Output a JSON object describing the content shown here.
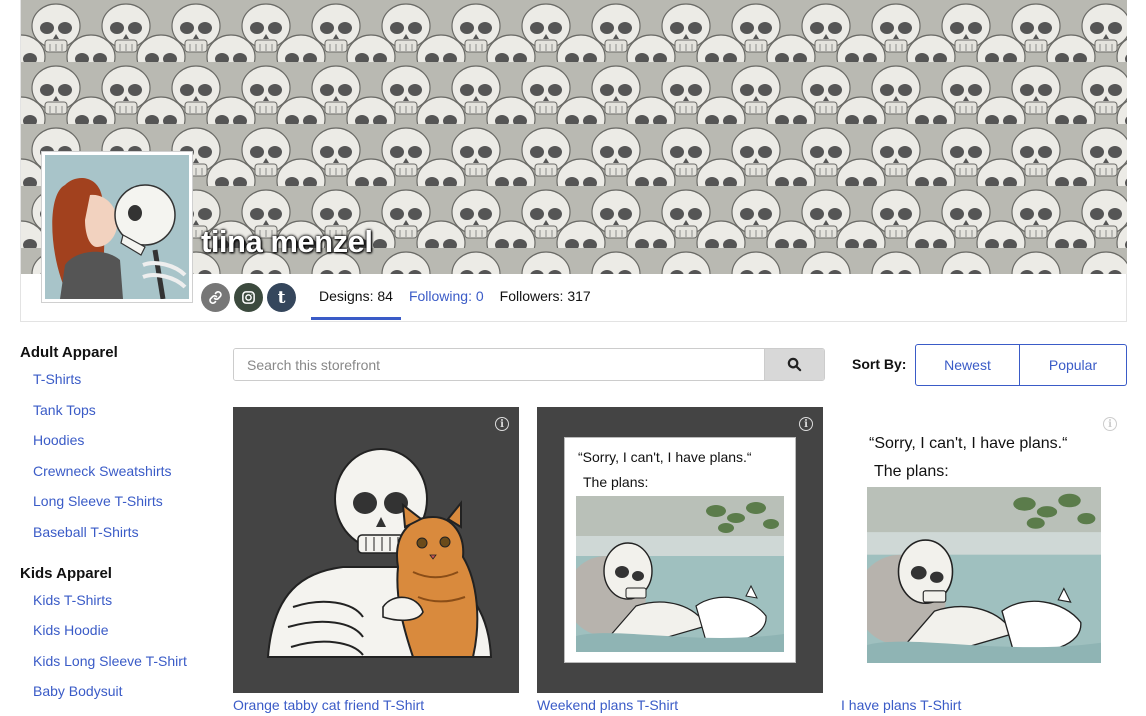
{
  "store": {
    "name": "tiina menzel",
    "designs_label": "Designs: 84",
    "following_label": "Following: 0",
    "followers_label": "Followers: 317"
  },
  "social": [
    {
      "icon": "link-icon"
    },
    {
      "icon": "instagram-icon"
    },
    {
      "icon": "tumblr-icon",
      "glyph": "t"
    }
  ],
  "sidebar": {
    "adult_heading": "Adult Apparel",
    "adult_items": [
      "T-Shirts",
      "Tank Tops",
      "Hoodies",
      "Crewneck Sweatshirts",
      "Long Sleeve T-Shirts",
      "Baseball T-Shirts"
    ],
    "kids_heading": "Kids Apparel",
    "kids_items": [
      "Kids T-Shirts",
      "Kids Hoodie",
      "Kids Long Sleeve T-Shirt",
      "Baby Bodysuit"
    ]
  },
  "search": {
    "placeholder": "Search this storefront"
  },
  "sort": {
    "label": "Sort By:",
    "newest": "Newest",
    "popular": "Popular"
  },
  "products": [
    {
      "title": "Orange tabby cat friend T-Shirt"
    },
    {
      "title": "Weekend plans T-Shirt",
      "caption_line1": "“Sorry, I can't, I have plans.“",
      "caption_line2": "The plans:"
    },
    {
      "title": "I have plans T-Shirt",
      "caption_line1": "“Sorry, I can't, I have plans.“",
      "caption_line2": "The plans:"
    }
  ],
  "colors": {
    "accent": "#3a5bc7",
    "dark_tile": "#444444"
  }
}
